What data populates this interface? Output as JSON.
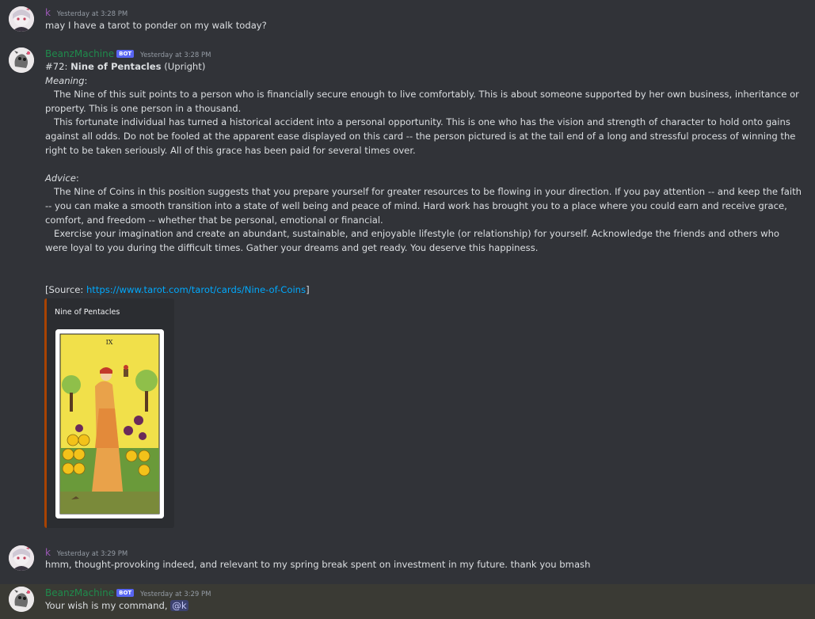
{
  "messages": [
    {
      "username": "k",
      "timestamp": "Yesterday at 3:28 PM",
      "text": "may I have a tarot to ponder on my walk today?"
    },
    {
      "username": "BeanzMachine",
      "bot_tag": "BOT",
      "timestamp": "Yesterday at 3:28 PM",
      "card_prefix": "#72: ",
      "card_name": "Nine of Pentacles",
      "card_orientation": " (Upright)",
      "meaning_label": "Meaning",
      "meaning_p1": "The Nine of this suit points to a person who is financially secure enough to live comfortably. This is about someone supported by her own business, inheritance or property. This is one person in a thousand.",
      "meaning_p2": "This fortunate individual has turned a historical accident into a personal opportunity. This is one who has the vision and strength of character to hold onto gains against all odds. Do not be fooled at the apparent ease displayed on this card -- the person pictured is at the tail end of a long and stressful process of winning the right to be taken seriously. All of this grace has been paid for several times over.",
      "advice_label": "Advice",
      "advice_p1": "The Nine of Coins in this position suggests that you prepare yourself for greater resources to be flowing in your direction. If you pay attention -- and keep the faith -- you can make a smooth transition into a state of well being and peace of mind. Hard work has brought you to a place where you could earn and receive grace, comfort, and freedom -- whether that be personal, emotional or financial.",
      "advice_p2": "Exercise your imagination and create an abundant, sustainable, and enjoyable lifestyle (or relationship) for yourself. Acknowledge the friends and others who were loyal to you during the difficult times. Gather your dreams and get ready. You deserve this happiness.",
      "source_prefix": "[Source: ",
      "source_url": "https://www.tarot.com/tarot/cards/Nine-of-Coins",
      "source_suffix": "]",
      "embed_title": "Nine of Pentacles",
      "card_numeral": "IX"
    },
    {
      "username": "k",
      "timestamp": "Yesterday at 3:29 PM",
      "text": "hmm, thought-provoking indeed, and relevant to my spring break spent on investment in my future. thank you bmash"
    },
    {
      "username": "BeanzMachine",
      "bot_tag": "BOT",
      "timestamp": "Yesterday at 3:29 PM",
      "text": "Your wish is my command, ",
      "mention": "@k"
    }
  ],
  "colors": {
    "background": "#313338",
    "user_k": "#9b59b6",
    "user_bot": "#1f8b4c",
    "link": "#00a8fc",
    "embed_border": "#a84300",
    "bot_tag": "#5865f2"
  }
}
